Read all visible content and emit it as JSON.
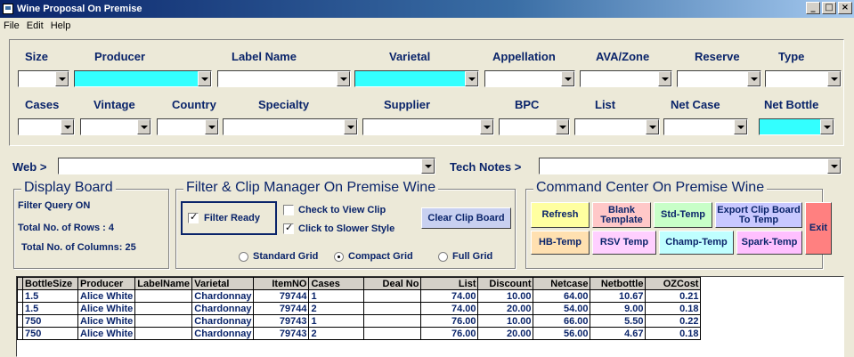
{
  "window": {
    "title": "Wine Proposal On Premise"
  },
  "menu": [
    "File",
    "Edit",
    "Help"
  ],
  "filters_row1": [
    "Size",
    "Producer",
    "Label Name",
    "Varietal",
    "Appellation",
    "AVA/Zone",
    "Reserve",
    "Type"
  ],
  "filters_row2": [
    "Cases",
    "Vintage",
    "Country",
    "Specialty",
    "Supplier",
    "BPC",
    "List",
    "Net Case",
    "Net Bottle"
  ],
  "highlight_color": "#33ffff",
  "web": {
    "label": "Web >"
  },
  "tech_notes": {
    "label": "Tech Notes >"
  },
  "display_board": {
    "title": "Display Board",
    "filter_query": "Filter Query ON",
    "rows": "Total No. of Rows : 4",
    "columns": "Total No. of Columns: 25"
  },
  "filter_clip": {
    "title": "Filter & Clip Manager On Premise Wine",
    "filter_ready": "Filter Ready",
    "check_view_clip": "Check to View Clip",
    "click_slower": "Click to Slower  Style",
    "clear_clip": "Clear Clip Board",
    "grid_options": [
      "Standard Grid",
      "Compact Grid",
      "Full Grid"
    ],
    "selected_grid": "Compact Grid"
  },
  "command_center": {
    "title": "Command Center On Premise Wine",
    "buttons": {
      "refresh": "Refresh",
      "blank_template": "Blank Template",
      "std_temp": "Std-Temp",
      "export_clip": "Export Clip Board To Temp",
      "exit": "Exit",
      "hb_temp": "HB-Temp",
      "rsv_temp": "RSV Temp",
      "champ_temp": "Champ-Temp",
      "spark_temp": "Spark-Temp"
    }
  },
  "grid": {
    "columns": [
      "BottleSize",
      "Producer",
      "LabelName",
      "Varietal",
      "ItemNO",
      "Cases",
      "Deal No",
      "List",
      "Discount",
      "Netcase",
      "Netbottle",
      "OZCost"
    ],
    "rows": [
      [
        "1.5",
        "Alice White",
        "",
        "Chardonnay",
        "79744",
        "1",
        "",
        "74.00",
        "10.00",
        "64.00",
        "10.67",
        "0.21"
      ],
      [
        "1.5",
        "Alice White",
        "",
        "Chardonnay",
        "79744",
        "2",
        "",
        "74.00",
        "20.00",
        "54.00",
        "9.00",
        "0.18"
      ],
      [
        "750",
        "Alice White",
        "",
        "Chardonnay",
        "79743",
        "1",
        "",
        "76.00",
        "10.00",
        "66.00",
        "5.50",
        "0.22"
      ],
      [
        "750",
        "Alice White",
        "",
        "Chardonnay",
        "79743",
        "2",
        "",
        "76.00",
        "20.00",
        "56.00",
        "4.67",
        "0.18"
      ]
    ]
  }
}
